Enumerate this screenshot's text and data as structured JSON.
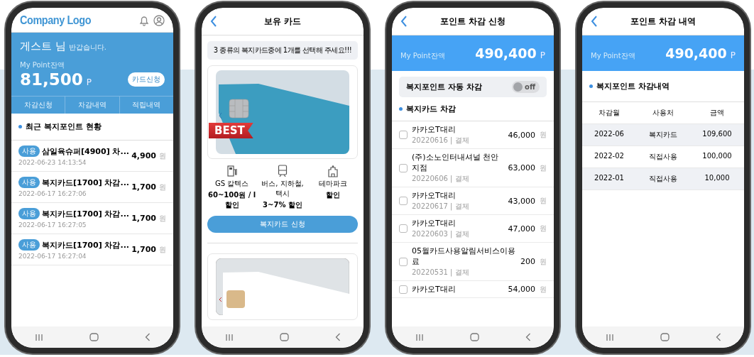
{
  "phones": [
    {
      "kind": "home",
      "logo": "Company Logo",
      "greeting_name": "게스트 님",
      "greeting_text": "반갑습니다.",
      "balance_label": "My Point잔액",
      "balance": "81,500",
      "unit": "P",
      "apply_button": "카드신청",
      "tabs": [
        "차감신청",
        "차감내역",
        "적립내역"
      ],
      "section_title": "최근 복지포인트 현황",
      "items": [
        {
          "badge": "사용",
          "title": "삼일육슈퍼[4900] 차...",
          "date": "2022-06-23 14:13:54",
          "amount": "4,900",
          "currency": "원"
        },
        {
          "badge": "사용",
          "title": "복지카드[1700] 차감...",
          "date": "2022-06-17 16:27:06",
          "amount": "1,700",
          "currency": "원"
        },
        {
          "badge": "사용",
          "title": "복지카드[1700] 차감...",
          "date": "2022-06-17 16:27:05",
          "amount": "1,700",
          "currency": "원"
        },
        {
          "badge": "사용",
          "title": "복지카드[1700] 차감...",
          "date": "2022-06-17 16:27:04",
          "amount": "1,700",
          "currency": "원"
        }
      ]
    },
    {
      "kind": "cards",
      "title": "보유 카드",
      "notice": "3 종류의 복지카드중에 1개를 선택해 주세요!!!",
      "ribbon": "BEST",
      "benefits": [
        {
          "kind": "fuel",
          "name": "GS 칼텍스",
          "detail": "60~100원 / l 할인"
        },
        {
          "kind": "transit",
          "name": "버스, 지하철, 택시",
          "detail": "3~7% 할인"
        },
        {
          "kind": "park",
          "name": "테마파크",
          "detail": "할인"
        }
      ],
      "apply_button": "복지카드 신청"
    },
    {
      "kind": "deduction",
      "title": "포인트 차감 신청",
      "balance_label": "My Point잔액",
      "balance": "490,400",
      "unit": "P",
      "auto_label": "복지포인트 자동 차감",
      "auto": {
        "on": false,
        "label": "off"
      },
      "section_title": "복지카드 차감",
      "items": [
        {
          "name": "카카오T대리",
          "meta": "20220616 | 결제",
          "amount": "46,000",
          "currency": "원",
          "checked": false
        },
        {
          "name": "(주)소노인터내셔널 천안지점",
          "meta": "20220606 | 결제",
          "amount": "63,000",
          "currency": "원",
          "checked": false
        },
        {
          "name": "카카오T대리",
          "meta": "20220617 | 결제",
          "amount": "43,000",
          "currency": "원",
          "checked": false
        },
        {
          "name": "카카오T대리",
          "meta": "20220603 | 결제",
          "amount": "47,000",
          "currency": "원",
          "checked": false
        },
        {
          "name": "05월카드사용알림서비스이용료",
          "meta": "20220531 | 결제",
          "amount": "200",
          "currency": "원",
          "checked": false
        },
        {
          "name": "카카오T대리",
          "amount": "54,000",
          "currency": "원",
          "checked": false
        }
      ]
    },
    {
      "kind": "history",
      "title": "포인트 차감 내역",
      "balance_label": "My Point잔액",
      "balance": "490,400",
      "unit": "P",
      "section_title": "복지포인트 차감내역",
      "columns": [
        "차감월",
        "사용처",
        "금액"
      ],
      "rows": [
        [
          "2022-06",
          "복지카드",
          "109,600"
        ],
        [
          "2022-02",
          "직접사용",
          "100,000"
        ],
        [
          "2022-01",
          "직접사용",
          "10,000"
        ]
      ]
    }
  ]
}
